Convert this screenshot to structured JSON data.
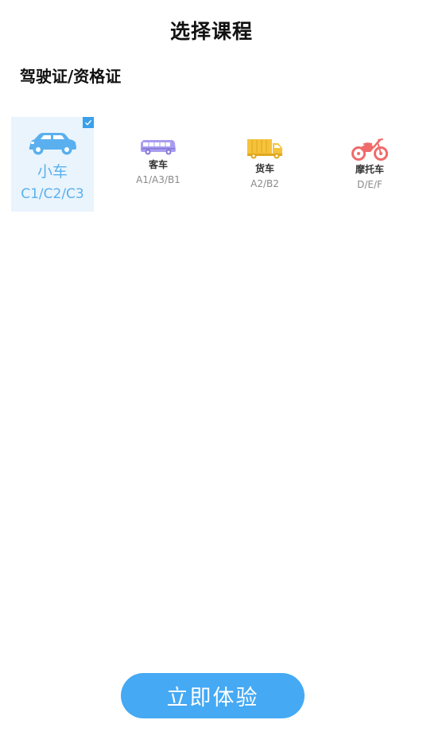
{
  "header": {
    "title": "选择课程"
  },
  "section": {
    "title": "驾驶证/资格证"
  },
  "courses": [
    {
      "name": "小车",
      "codes": "C1/C2/C3",
      "icon": "car-icon",
      "color": "#5ab0ee",
      "selected": true
    },
    {
      "name": "客车",
      "codes": "A1/A3/B1",
      "icon": "bus-icon",
      "color": "#a99cf0",
      "selected": false
    },
    {
      "name": "货车",
      "codes": "A2/B2",
      "icon": "truck-icon",
      "color": "#f5c23b",
      "selected": false
    },
    {
      "name": "摩托车",
      "codes": "D/E/F",
      "icon": "motorcycle-icon",
      "color": "#f06a6a",
      "selected": false
    }
  ],
  "cta": {
    "label": "立即体验",
    "color": "#45a9f4"
  }
}
